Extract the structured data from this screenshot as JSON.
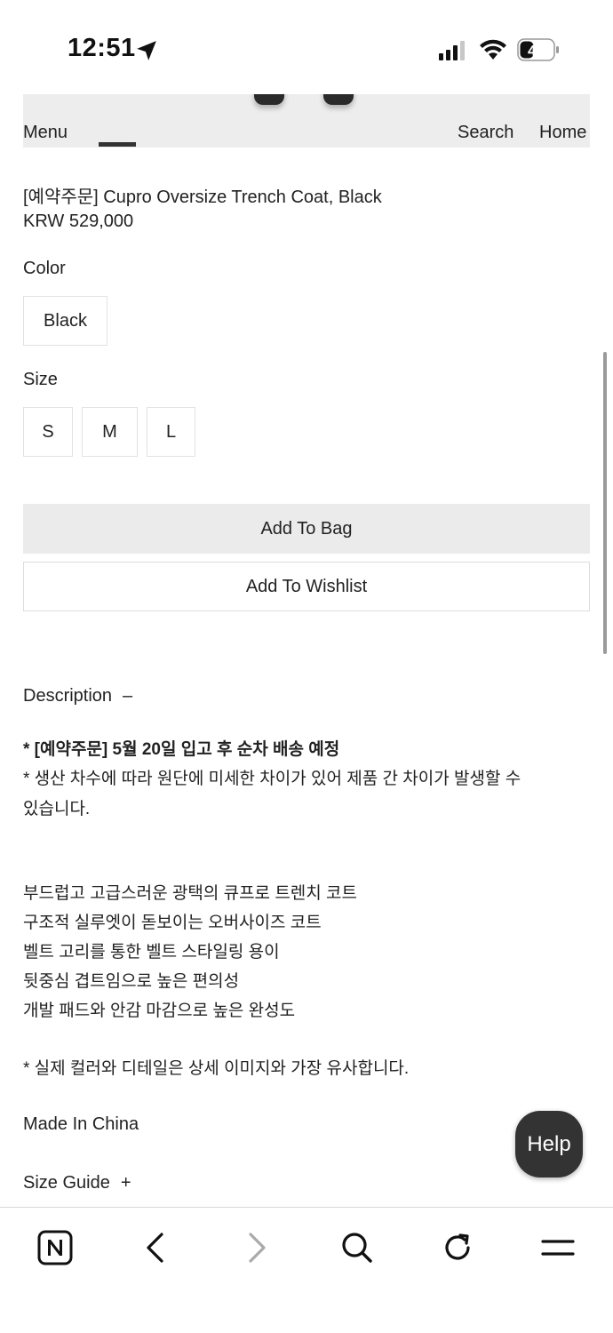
{
  "status_bar": {
    "time": "12:51",
    "battery": "40",
    "icons": [
      "location-arrow-icon",
      "signal-icon",
      "wifi-icon",
      "battery-icon"
    ]
  },
  "nav": {
    "menu": "Menu",
    "search": "Search",
    "home": "Home"
  },
  "product": {
    "title": "[예약주문] Cupro Oversize Trench Coat, Black",
    "price": "KRW 529,000",
    "color_label": "Color",
    "color_options": [
      "Black"
    ],
    "size_label": "Size",
    "size_options": [
      "S",
      "M",
      "L"
    ],
    "add_to_bag": "Add To Bag",
    "add_to_wishlist": "Add To Wishlist"
  },
  "description": {
    "heading": "Description",
    "toggle": "–",
    "notice_bold": "* [예약주문] 5월 20일 입고 후 순차 배송 예정",
    "notice_1": "* 생산 차수에 따라 원단에 미세한 차이가 있어 제품 간 차이가 발생할 수",
    "notice_2": "있습니다.",
    "features": [
      "부드럽고 고급스러운 광택의 큐프로 트렌치 코트",
      "구조적 실루엣이 돋보이는 오버사이즈 코트",
      "벨트 고리를 통한 벨트 스타일링 용이",
      "뒷중심 겹트임으로 높은 편의성",
      "개발 패드와 안감 마감으로 높은 완성도"
    ],
    "color_note": "* 실제 컬러와 디테일은 상세 이미지와 가장 유사합니다.",
    "origin": "Made In China"
  },
  "size_guide": {
    "label": "Size Guide",
    "toggle": "+"
  },
  "help": {
    "label": "Help"
  },
  "toolbar": {
    "icons": [
      "naver-n-icon",
      "back-arrow-icon",
      "forward-arrow-icon",
      "search-icon",
      "refresh-icon",
      "menu-icon"
    ]
  },
  "colors": {
    "button_gray": "#ebebeb",
    "help_bg": "#333333",
    "text": "#222222"
  }
}
